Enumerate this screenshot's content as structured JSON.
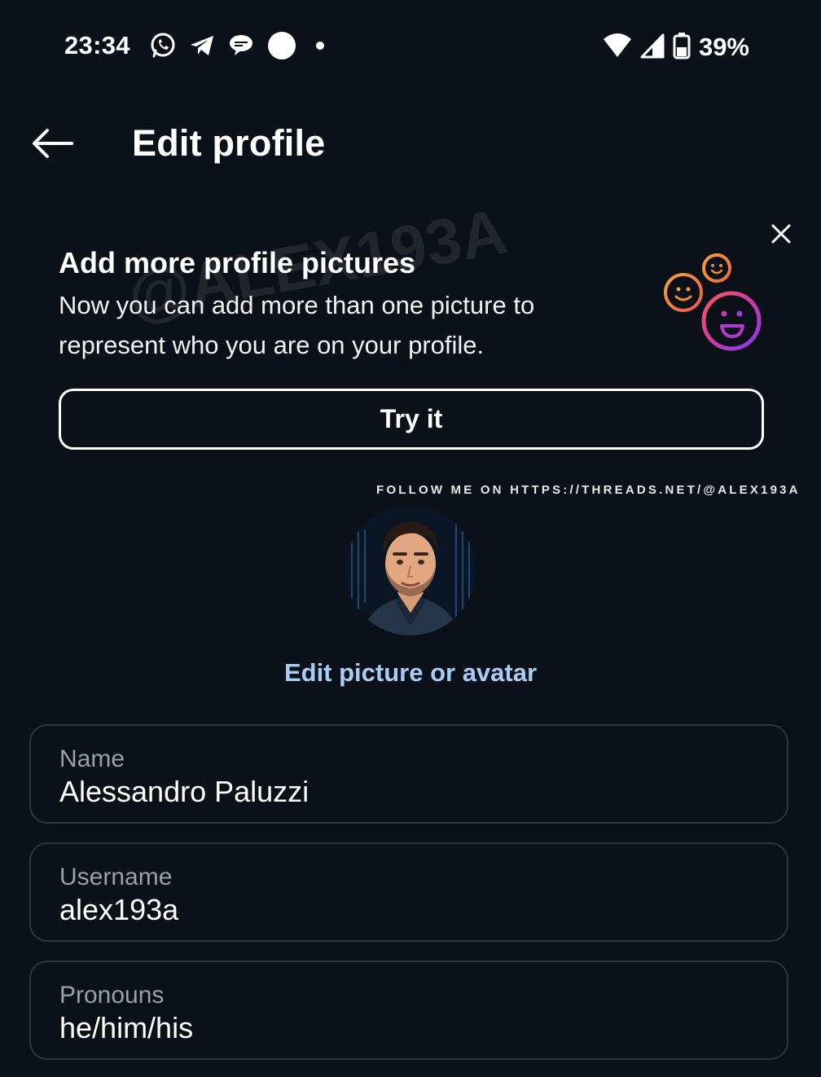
{
  "status_bar": {
    "time": "23:34",
    "battery": "39%",
    "icons_left": [
      "whatsapp-icon",
      "telegram-icon",
      "threads-chat-icon",
      "circle-icon",
      "dot-icon"
    ],
    "icons_right": [
      "wifi-icon",
      "signal-icon",
      "battery-icon"
    ]
  },
  "header": {
    "title": "Edit profile",
    "back_icon": "arrow-left-icon"
  },
  "banner": {
    "title": "Add more profile pictures",
    "body": "Now you can add more than one picture to represent who you are on your profile.",
    "button_label": "Try it",
    "close_icon": "close-icon",
    "watermark": "@ALEX193A"
  },
  "follow_note": "FOLLOW ME ON HTTPS://THREADS.NET/@ALEX193A",
  "profile": {
    "edit_link": "Edit picture or avatar"
  },
  "fields": [
    {
      "label": "Name",
      "value": "Alessandro Paluzzi"
    },
    {
      "label": "Username",
      "value": "alex193a"
    },
    {
      "label": "Pronouns",
      "value": "he/him/his"
    }
  ],
  "colors": {
    "background": "#0c1018",
    "link": "#a8cdf5",
    "field_border": "#2e3440",
    "label": "#9aa0a8"
  }
}
